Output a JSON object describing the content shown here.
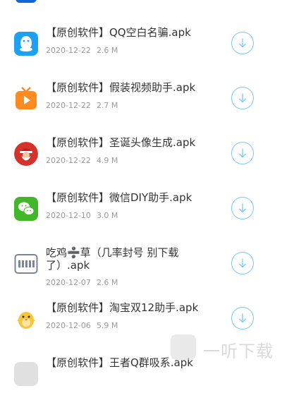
{
  "items": [
    {
      "title": "【原创软件】QQ空白名骗.apk",
      "date": "2020-12-22",
      "size": "2.6 M",
      "icon": "qq-icon"
    },
    {
      "title": "【原创软件】假装视频助手.apk",
      "date": "2020-12-22",
      "size": "2.7 M",
      "icon": "video-tv-icon"
    },
    {
      "title": "【原创软件】圣诞头像生成.apk",
      "date": "2020-12-22",
      "size": "4.9 M",
      "icon": "santa-icon"
    },
    {
      "title": "【原创软件】微信DIY助手.apk",
      "date": "2020-12-10",
      "size": "3.0 M",
      "icon": "wechat-icon"
    },
    {
      "title": "吃鸡➗草（几率封号 别下载了）.apk",
      "date": "2020-12-07",
      "size": "2.6 M",
      "icon": "pubg-icon"
    },
    {
      "title": "【原创软件】淘宝双12助手.apk",
      "date": "2020-12-06",
      "size": "5.9 M",
      "icon": "chick-icon"
    },
    {
      "title": "【原创软件】王者Q群吸系.apk",
      "date": "",
      "size": "",
      "icon": "app-icon"
    }
  ],
  "watermark": {
    "logo_text": "听",
    "text": "一听下载"
  },
  "colors": {
    "accent": "#7cc9f2",
    "title": "#333333",
    "meta": "#9a9a9a"
  }
}
